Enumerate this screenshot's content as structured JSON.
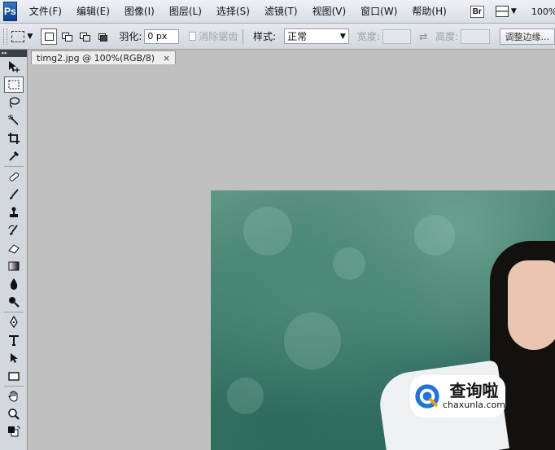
{
  "app": {
    "logo": "Ps"
  },
  "menu": {
    "items": [
      "文件(F)",
      "编辑(E)",
      "图像(I)",
      "图层(L)",
      "选择(S)",
      "滤镜(T)",
      "视图(V)",
      "窗口(W)",
      "帮助(H)"
    ],
    "bridge_label": "Br",
    "zoom_value": "100%"
  },
  "options": {
    "feather_label": "羽化:",
    "feather_value": "0 px",
    "antialias_label": "消除锯齿",
    "style_label": "样式:",
    "style_value": "正常",
    "width_label": "宽度:",
    "height_label": "高度:",
    "adjust_edge_label": "调整边缘..."
  },
  "panel": {
    "collapse_label": "▸▸"
  },
  "document": {
    "tab_title": "timg2.jpg @ 100%(RGB/8)",
    "close_label": "×"
  },
  "watermark": {
    "cn_text": "查询啦",
    "en_text": "chaxunla.com"
  },
  "icons": [
    "move-icon",
    "marquee-icon",
    "lasso-icon",
    "quick-select-icon",
    "crop-icon",
    "eyedropper-icon",
    "healing-brush-icon",
    "brush-icon",
    "clone-stamp-icon",
    "history-brush-icon",
    "eraser-icon",
    "gradient-icon",
    "blur-icon",
    "dodge-icon",
    "pen-icon",
    "type-icon",
    "path-select-icon",
    "shape-icon",
    "hand-icon",
    "zoom-icon",
    "color-swatch-icon"
  ],
  "colors": {
    "logo_blue": "#1a5aab",
    "canvas_gray": "#c0c0c0",
    "panel": "#d3d7de"
  }
}
